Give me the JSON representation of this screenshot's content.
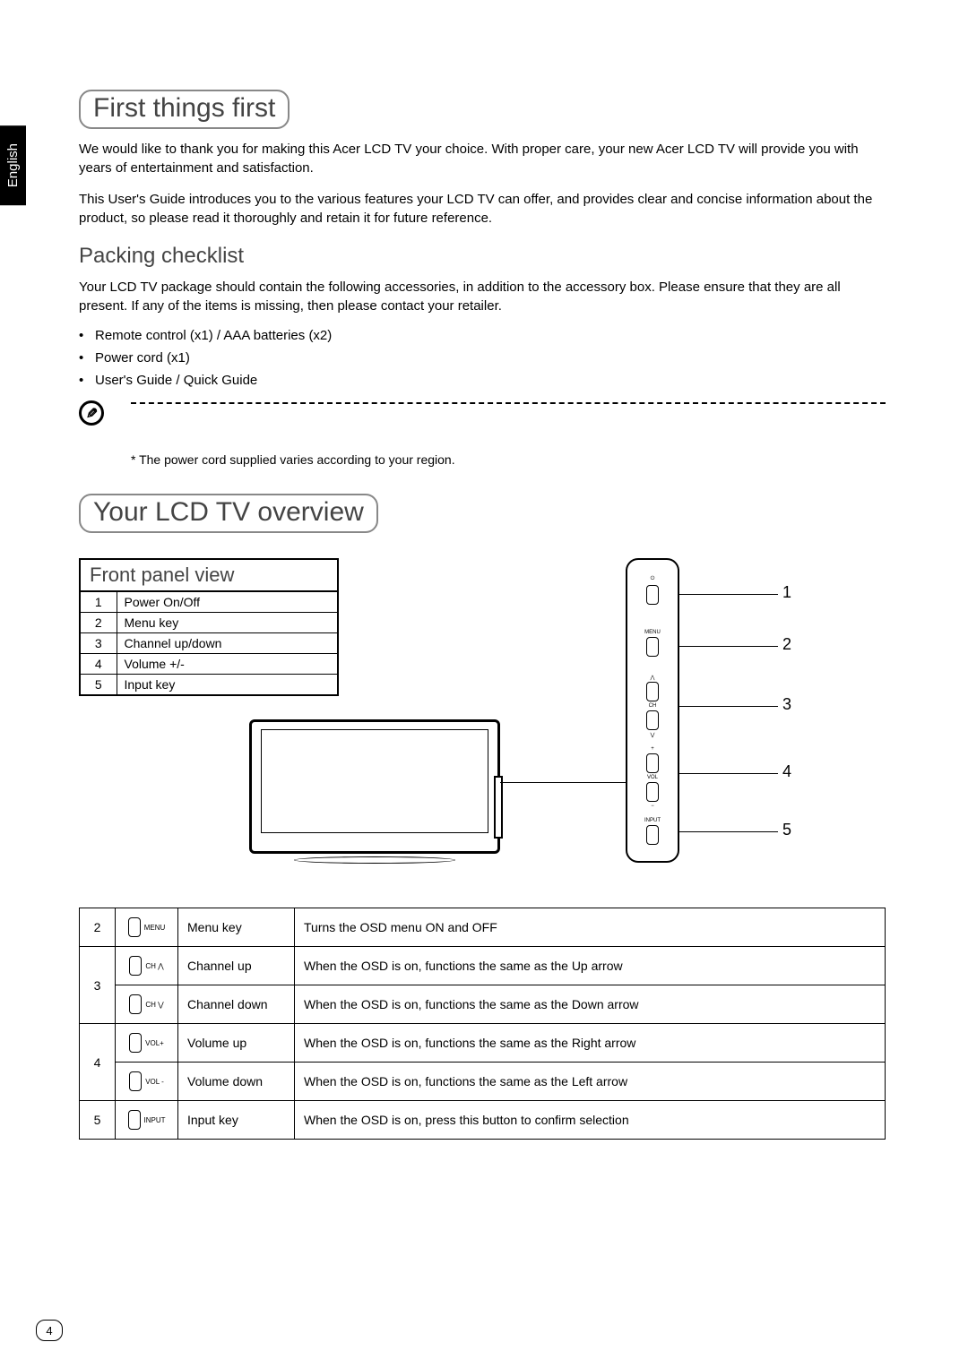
{
  "language_tab": "English",
  "page_number": "4",
  "section1": {
    "title": "First things first",
    "p1": "We would like to thank you for making this Acer LCD TV your choice. With proper care, your new Acer LCD TV will provide you with years of entertainment and satisfaction.",
    "p2": "This User's Guide introduces you to the various features your LCD TV can offer, and provides clear and concise information about the product, so please read it thoroughly and retain it for future reference.",
    "subhead": "Packing checklist",
    "p3": "Your LCD TV package should contain the following accessories, in addition to the accessory box. Please ensure that they are all present. If any of the items is missing, then please contact your retailer.",
    "items": [
      "Remote control (x1) / AAA batteries (x2)",
      "Power cord (x1)",
      "User's Guide / Quick Guide"
    ],
    "note": "*  The power cord supplied varies according to your region."
  },
  "section2": {
    "title": "Your LCD TV overview",
    "panel_head": "Front panel view",
    "panel_rows": [
      {
        "n": "1",
        "label": "Power On/Off"
      },
      {
        "n": "2",
        "label": "Menu key"
      },
      {
        "n": "3",
        "label": "Channel up/down"
      },
      {
        "n": "4",
        "label": "Volume +/-"
      },
      {
        "n": "5",
        "label": "Input key"
      }
    ],
    "callouts": [
      "1",
      "2",
      "3",
      "4",
      "5"
    ],
    "side_labels": {
      "menu": "MENU",
      "ch": "CH",
      "vol": "VOL",
      "input": "INPUT"
    },
    "func_rows": [
      {
        "n": "2",
        "btn": "MENU",
        "name": "Menu key",
        "desc": "Turns the OSD menu ON and OFF"
      },
      {
        "n": "3",
        "btn": "CH ⋀",
        "name": "Channel up",
        "desc": "When the OSD is on, functions the same as the Up arrow"
      },
      {
        "n": "",
        "btn": "CH ⋁",
        "name": "Channel down",
        "desc": "When the OSD is on, functions the same as the Down arrow"
      },
      {
        "n": "4",
        "btn": "VOL+",
        "name": "Volume up",
        "desc": "When the OSD is on, functions the same as the Right arrow"
      },
      {
        "n": "",
        "btn": "VOL -",
        "name": "Volume down",
        "desc": "When the OSD is on, functions the same as the Left arrow"
      },
      {
        "n": "5",
        "btn": "INPUT",
        "name": "Input key",
        "desc": "When the OSD is on, press this button to confirm selection"
      }
    ]
  }
}
